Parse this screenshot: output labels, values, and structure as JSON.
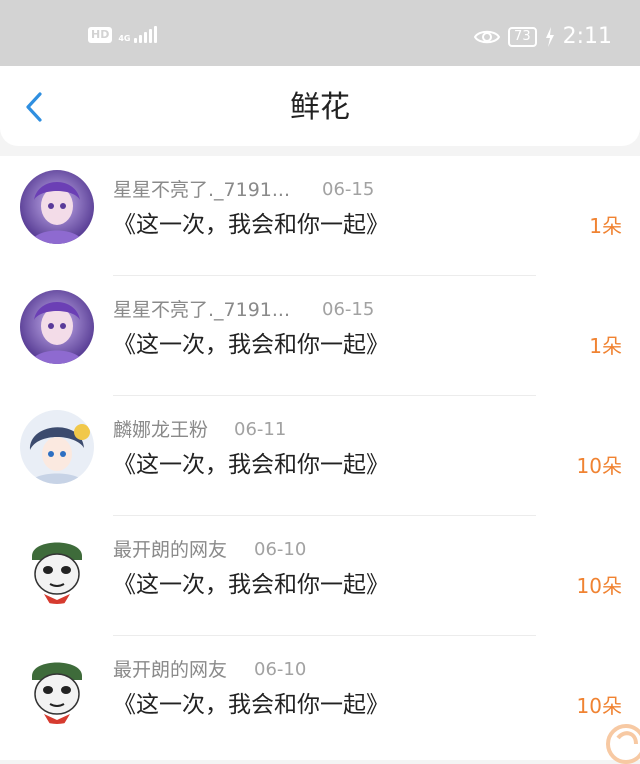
{
  "status_bar": {
    "hd": "HD",
    "network": "4G",
    "battery": "73",
    "time": "2:11"
  },
  "header": {
    "title": "鲜花"
  },
  "gifts": [
    {
      "user": "星星不亮了._7191...",
      "date": "06-15",
      "message": "《这一次，我会和你一起》",
      "amount": "1朵",
      "avatar": "purple-girl"
    },
    {
      "user": "星星不亮了._7191...",
      "date": "06-15",
      "message": "《这一次，我会和你一起》",
      "amount": "1朵",
      "avatar": "purple-girl"
    },
    {
      "user": "麟娜龙王粉",
      "date": "06-11",
      "message": "《这一次，我会和你一起》",
      "amount": "10朵",
      "avatar": "anime-boy"
    },
    {
      "user": "最开朗的网友",
      "date": "06-10",
      "message": "《这一次，我会和你一起》",
      "amount": "10朵",
      "avatar": "panda-meme"
    },
    {
      "user": "最开朗的网友",
      "date": "06-10",
      "message": "《这一次，我会和你一起》",
      "amount": "10朵",
      "avatar": "panda-meme"
    }
  ],
  "colors": {
    "accent_back": "#2f8fe0",
    "amount": "#f08332",
    "status_bar_bg": "#d3d3d3"
  }
}
